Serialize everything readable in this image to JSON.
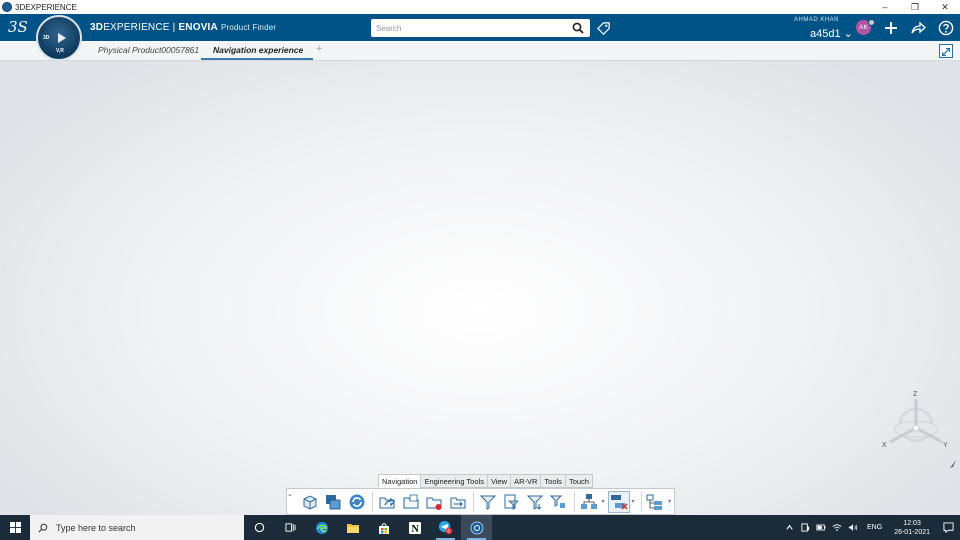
{
  "window": {
    "title": "3DEXPERIENCE",
    "minimize": "–",
    "restore": "❐",
    "close": "✕"
  },
  "topbar": {
    "brand_bold": "3D",
    "brand_rest": "EXPERIENCE",
    "brand_sep": " | ",
    "brand_product": "ENOVIA",
    "app_name": "Product Finder",
    "search_placeholder": "Search",
    "user_name": "AHMAD KHAN",
    "tenant": "a45d1 ⌄",
    "avatar_initials": "AK"
  },
  "compass": {
    "label_3d": "3D",
    "label_version": "V,R"
  },
  "tabs": {
    "items": [
      "Physical Product00057861",
      "Navigation experience"
    ],
    "active": 1,
    "add": "+"
  },
  "canvas": {
    "expand_arrow": "›"
  },
  "robot": {
    "axis_z": "Z",
    "axis_x": "X",
    "axis_y": "Y"
  },
  "action_bar": {
    "tabs": [
      "Navigation",
      "Engineering Tools",
      "View",
      "AR-VR",
      "Tools",
      "Touch"
    ],
    "active_tab": "Navigation",
    "collapse": "⌄"
  },
  "taskbar": {
    "search_placeholder": "Type here to search",
    "language": "ENG",
    "time": "12:03",
    "date": "26-01-2021",
    "badge_count": "6"
  },
  "colors": {
    "topbar": "#005386",
    "accent": "#3c7ab4",
    "avatar": "#b454a4",
    "taskbar": "#1c2b3a"
  }
}
